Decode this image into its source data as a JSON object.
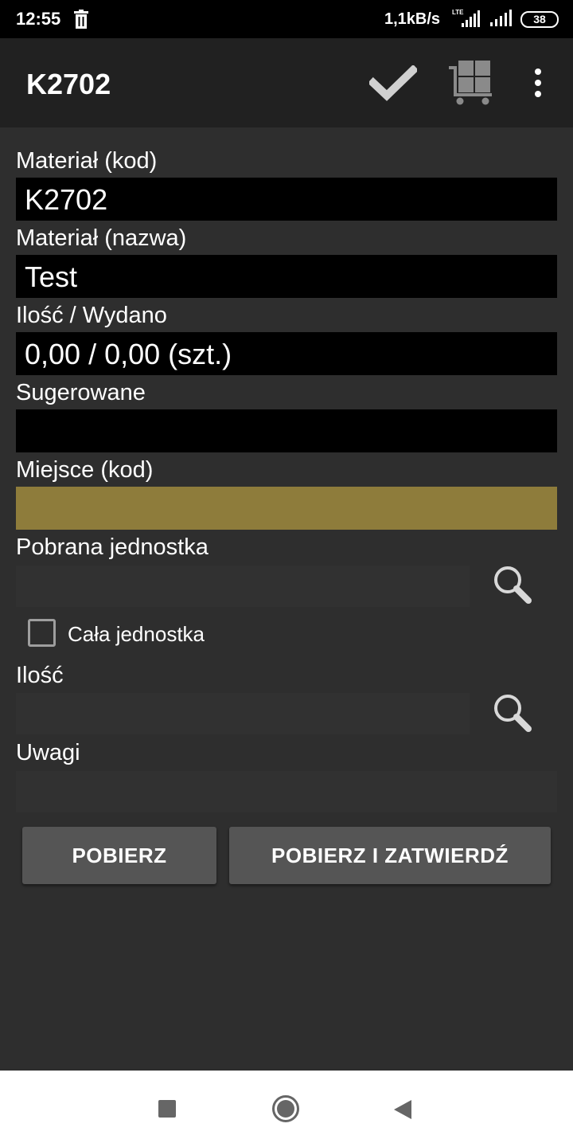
{
  "status_bar": {
    "time": "12:55",
    "net_speed": "1,1kB/s",
    "network_type": "LTE",
    "battery": "38"
  },
  "app_bar": {
    "title": "K2702",
    "actions": [
      "check-icon",
      "cart-icon",
      "more-vert-icon"
    ]
  },
  "form": {
    "material_code": {
      "label": "Materiał (kod)",
      "value": "K2702"
    },
    "material_name": {
      "label": "Materiał (nazwa)",
      "value": "Test"
    },
    "quantity_issued": {
      "label": "Ilość / Wydano",
      "value": "0,00 / 0,00 (szt.)"
    },
    "suggested": {
      "label": "Sugerowane",
      "value": ""
    },
    "location_code": {
      "label": "Miejsce (kod)",
      "value": ""
    },
    "picked_unit": {
      "label": "Pobrana jednostka",
      "value": ""
    },
    "whole_unit": {
      "label": "Cała jednostka",
      "checked": false
    },
    "quantity": {
      "label": "Ilość",
      "value": ""
    },
    "notes": {
      "label": "Uwagi",
      "value": ""
    }
  },
  "buttons": {
    "take": "POBIERZ",
    "take_confirm": "POBIERZ I ZATWIERDŹ"
  },
  "colors": {
    "background": "#2e2e2e",
    "app_bar": "#212121",
    "location_field": "#8e7c3b",
    "button": "#555555"
  }
}
